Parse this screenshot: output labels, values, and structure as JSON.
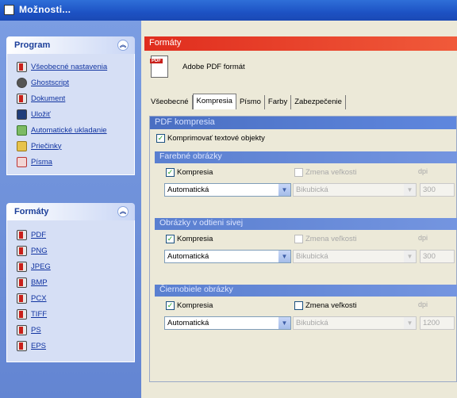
{
  "window": {
    "title": "Možnosti..."
  },
  "program_panel": {
    "title": "Program",
    "items": [
      {
        "label": "Všeobecné nastavenia",
        "icon": "settings-icon"
      },
      {
        "label": "Ghostscript",
        "icon": "ghostscript-icon"
      },
      {
        "label": "Dokument",
        "icon": "document-icon"
      },
      {
        "label": "Uložiť",
        "icon": "save-icon"
      },
      {
        "label": "Automatické ukladanie",
        "icon": "auto-save-icon"
      },
      {
        "label": "Priečinky",
        "icon": "folder-icon"
      },
      {
        "label": "Písma",
        "icon": "font-icon"
      }
    ]
  },
  "formats_panel": {
    "title": "Formáty",
    "items": [
      {
        "label": "PDF"
      },
      {
        "label": "PNG"
      },
      {
        "label": "JPEG"
      },
      {
        "label": "BMP"
      },
      {
        "label": "PCX"
      },
      {
        "label": "TIFF"
      },
      {
        "label": "PS"
      },
      {
        "label": "EPS"
      }
    ]
  },
  "main": {
    "header": "Formáty",
    "format_name": "Adobe PDF formát",
    "tabs": [
      "Všeobecné",
      "Kompresia",
      "Písmo",
      "Farby",
      "Zabezpečenie"
    ],
    "active_tab": "Kompresia",
    "section_title": "PDF kompresia",
    "compress_text_label": "Komprimovať textové objekty",
    "groups": [
      {
        "title": "Farebné obrázky",
        "compress_label": "Kompresia",
        "resize_label": "Zmena veľkosti",
        "dpi_label": "dpi",
        "method": "Automatická",
        "resample": "Bikubická",
        "dpi": "300"
      },
      {
        "title": "Obrázky v odtieni sivej",
        "compress_label": "Kompresia",
        "resize_label": "Zmena veľkosti",
        "dpi_label": "dpi",
        "method": "Automatická",
        "resample": "Bikubická",
        "dpi": "300"
      },
      {
        "title": "Čiernobiele obrázky",
        "compress_label": "Kompresia",
        "resize_label": "Zmena veľkosti",
        "dpi_label": "dpi",
        "method": "Automatická",
        "resample": "Bikubická",
        "dpi": "1200"
      }
    ]
  }
}
